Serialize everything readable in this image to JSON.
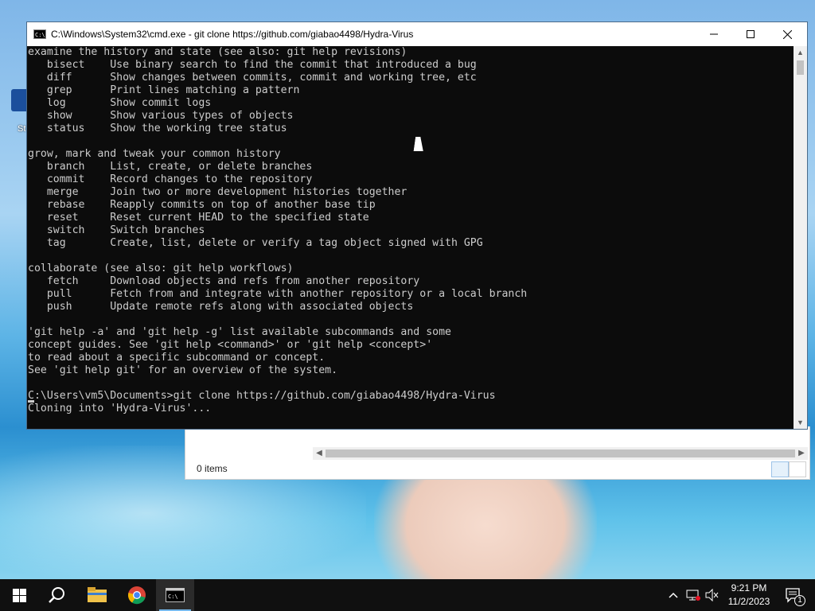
{
  "desktop": {
    "icon_label": "St"
  },
  "explorer": {
    "status_text": "0 items"
  },
  "cmd": {
    "title": "C:\\Windows\\System32\\cmd.exe - git  clone https://github.com/giabao4498/Hydra-Virus",
    "lines": [
      "examine the history and state (see also: git help revisions)",
      "   bisect    Use binary search to find the commit that introduced a bug",
      "   diff      Show changes between commits, commit and working tree, etc",
      "   grep      Print lines matching a pattern",
      "   log       Show commit logs",
      "   show      Show various types of objects",
      "   status    Show the working tree status",
      "",
      "grow, mark and tweak your common history",
      "   branch    List, create, or delete branches",
      "   commit    Record changes to the repository",
      "   merge     Join two or more development histories together",
      "   rebase    Reapply commits on top of another base tip",
      "   reset     Reset current HEAD to the specified state",
      "   switch    Switch branches",
      "   tag       Create, list, delete or verify a tag object signed with GPG",
      "",
      "collaborate (see also: git help workflows)",
      "   fetch     Download objects and refs from another repository",
      "   pull      Fetch from and integrate with another repository or a local branch",
      "   push      Update remote refs along with associated objects",
      "",
      "'git help -a' and 'git help -g' list available subcommands and some",
      "concept guides. See 'git help <command>' or 'git help <concept>'",
      "to read about a specific subcommand or concept.",
      "See 'git help git' for an overview of the system.",
      "",
      "C:\\Users\\vm5\\Documents>git clone https://github.com/giabao4498/Hydra-Virus",
      "Cloning into 'Hydra-Virus'..."
    ],
    "minimize_icon": "minimize-icon",
    "maximize_icon": "maximize-icon",
    "close_icon": "close-icon"
  },
  "taskbar": {
    "items": [
      "start-icon",
      "search-icon",
      "file-explorer-icon",
      "chrome-icon",
      "cmd-icon"
    ],
    "time": "9:21 PM",
    "date": "11/2/2023",
    "notification_count": "1",
    "accent_color": "#76b9ed"
  }
}
